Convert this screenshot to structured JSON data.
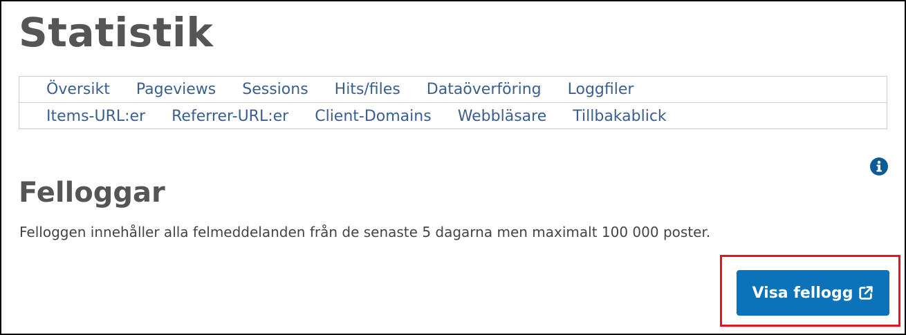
{
  "header": {
    "title": "Statistik"
  },
  "nav": {
    "row1": [
      {
        "label": "Översikt"
      },
      {
        "label": "Pageviews"
      },
      {
        "label": "Sessions"
      },
      {
        "label": "Hits/files"
      },
      {
        "label": "Dataöverföring"
      },
      {
        "label": "Loggfiler"
      }
    ],
    "row2": [
      {
        "label": "Items-URL:er"
      },
      {
        "label": "Referrer-URL:er"
      },
      {
        "label": "Client-Domains"
      },
      {
        "label": "Webbläsare"
      },
      {
        "label": "Tillbakablick"
      }
    ]
  },
  "section": {
    "title": "Felloggar",
    "description": "Felloggen innehåller alla felmeddelanden från de senaste 5 dagarna men maximalt 100 000 poster.",
    "button_label": "Visa fellogg",
    "button_icon": "external-link-icon",
    "info_icon": "info-icon"
  },
  "colors": {
    "primary": "#0c73bb",
    "link": "#3a5f8f",
    "highlight": "#e8141b",
    "heading": "#555555"
  }
}
